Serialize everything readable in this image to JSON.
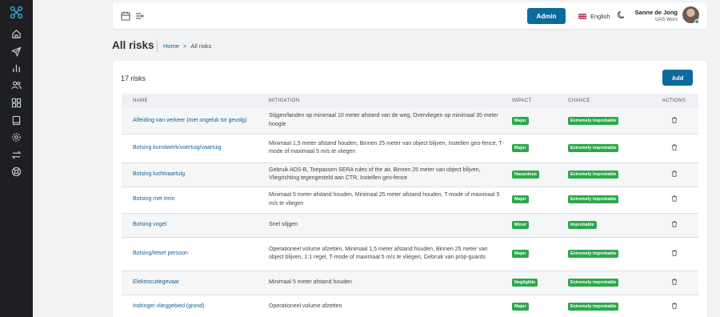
{
  "topbar": {
    "admin_label": "Admin",
    "language_label": "English",
    "user_name": "Sanne de Jong",
    "user_org": "UAS Worx"
  },
  "page": {
    "title": "All risks",
    "breadcrumb": {
      "home": "Home",
      "separator": ">",
      "current": "All risks"
    }
  },
  "risks": {
    "count_label": "17 risks",
    "add_label": "Add",
    "columns": {
      "name": "NAME",
      "mitigation": "MITIGATION",
      "impact": "IMPACT",
      "chance": "CHANCE",
      "actions": "ACTIONS"
    },
    "rows": [
      {
        "name": "Afleiding van verkeer (met ongeluk tot gevolg)",
        "mitigation": "Stijgen/landen op minimaal 10 meter afstand van de weg, Overvliegen op minimaal 35 meter hoogte",
        "impact": "Major",
        "chance": "Extremely improbable"
      },
      {
        "name": "Botsing kunstwerk/voertuig/vaartuig",
        "mitigation": "Minimaal 1,5 meter afstand houden, Binnen 25 meter van object blijven, Instellen geo-fence, T-mode of maximaal 5 m/s te vliegen",
        "impact": "Major",
        "chance": "Extremely improbable"
      },
      {
        "name": "Botsing luchtvaartuig",
        "mitigation": "Gebruik ADS-B, Toepassen SERA rules of the air, Binnen 25 meter van object blijven, Vliegrichting tegengesteld aan CTR, Instellen geo-fence",
        "impact": "Hazardous",
        "chance": "Extremely improbable"
      },
      {
        "name": "Botsing met trein",
        "mitigation": "Minimaal 5 meter afstand houden, Minimaal 25 meter afstand houden, T-mode of maximaal 5 m/s te vliegen",
        "impact": "Major",
        "chance": "Extremely improbable"
      },
      {
        "name": "Botsing vogel",
        "mitigation": "Snel stijgen",
        "impact": "Minor",
        "chance": "Improbable"
      },
      {
        "name": "Botsing/letsel persoon",
        "mitigation": "Operationeel volume afzetten, Minimaal 1,5 meter afstand houden, Binnen 25 meter van object blijven, 1:1 regel, T-mode of maximaal 5 m/s te vliegen, Gebruik van prop-guards",
        "impact": "Major",
        "chance": "Extremely improbable"
      },
      {
        "name": "Elektrocutiegevaar",
        "mitigation": "Minimaal 5 meter afstand houden",
        "impact": "Negligible",
        "chance": "Extremely improbable"
      },
      {
        "name": "Indringer vlieggebied (grond)",
        "mitigation": "Operationeel volume afzetten",
        "impact": "Major",
        "chance": "Extremely improbable"
      }
    ]
  },
  "colors": {
    "primary": "#0d6a9d",
    "badge_green": "#2ba84a",
    "sidebar": "#1d1f22",
    "link": "#0e6394"
  }
}
